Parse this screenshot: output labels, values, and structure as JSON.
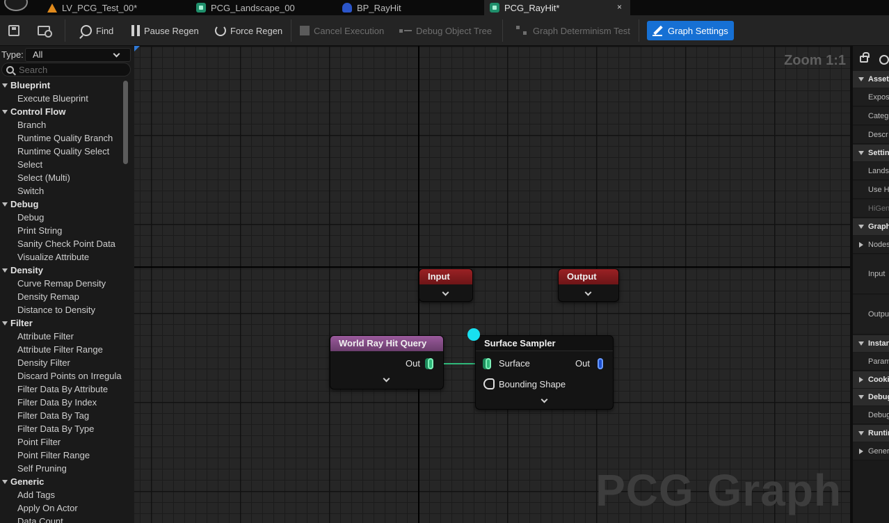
{
  "tabs": [
    {
      "label": "LV_PCG_Test_00*",
      "icon": "level-icon"
    },
    {
      "label": "PCG_Landscape_00",
      "icon": "pcg-graph-icon"
    },
    {
      "label": "BP_RayHit",
      "icon": "blueprint-icon"
    },
    {
      "label": "PCG_RayHit*",
      "icon": "pcg-graph-icon",
      "active": true
    }
  ],
  "tab_close_glyph": "×",
  "toolbar": {
    "find": "Find",
    "pause_regen": "Pause Regen",
    "force_regen": "Force Regen",
    "cancel_execution": "Cancel Execution",
    "debug_object_tree": "Debug Object Tree",
    "graph_determinism_test": "Graph Determinism Test",
    "graph_settings": "Graph Settings"
  },
  "palette": {
    "type_label": "Type:",
    "type_value": "All",
    "search_placeholder": "Search",
    "categories": [
      {
        "name": "Blueprint",
        "items": [
          "Execute Blueprint"
        ]
      },
      {
        "name": "Control Flow",
        "items": [
          "Branch",
          "Runtime Quality Branch",
          "Runtime Quality Select",
          "Select",
          "Select (Multi)",
          "Switch"
        ]
      },
      {
        "name": "Debug",
        "items": [
          "Debug",
          "Print String",
          "Sanity Check Point Data",
          "Visualize Attribute"
        ]
      },
      {
        "name": "Density",
        "items": [
          "Curve Remap Density",
          "Density Remap",
          "Distance to Density"
        ]
      },
      {
        "name": "Filter",
        "items": [
          "Attribute Filter",
          "Attribute Filter Range",
          "Density Filter",
          "Discard Points on Irregula",
          "Filter Data By Attribute",
          "Filter Data By Index",
          "Filter Data By Tag",
          "Filter Data By Type",
          "Point Filter",
          "Point Filter Range",
          "Self Pruning"
        ]
      },
      {
        "name": "Generic",
        "items": [
          "Add Tags",
          "Apply On Actor",
          "Data Count"
        ]
      }
    ]
  },
  "graph": {
    "zoom": "Zoom 1:1",
    "watermark": "PCG Graph",
    "nodes": {
      "input": {
        "title": "Input",
        "color": "#8f1d20"
      },
      "output": {
        "title": "Output",
        "color": "#8f1d20"
      },
      "world_ray_hit_query": {
        "title": "World Ray Hit Query",
        "color": "#8a4f8c",
        "out_label": "Out"
      },
      "surface_sampler": {
        "title": "Surface Sampler",
        "surface_label": "Surface",
        "out_label": "Out",
        "bounding_shape_label": "Bounding Shape"
      }
    }
  },
  "details": {
    "rows": [
      {
        "kind": "section",
        "label": "Asset"
      },
      {
        "kind": "prop",
        "label": "Expos"
      },
      {
        "kind": "prop",
        "label": "Categ"
      },
      {
        "kind": "prop",
        "label": "Descr"
      },
      {
        "kind": "section",
        "label": "Settin"
      },
      {
        "kind": "prop",
        "label": "Lands"
      },
      {
        "kind": "prop",
        "label": "Use H"
      },
      {
        "kind": "prop",
        "label": "HiGen",
        "dim": true
      },
      {
        "kind": "section",
        "label": "Graph"
      },
      {
        "kind": "prop",
        "label": "Nodes",
        "arrow": true
      },
      {
        "kind": "prop",
        "label": "Input",
        "tall": true
      },
      {
        "kind": "prop",
        "label": "Outpu",
        "tall": true
      },
      {
        "kind": "section",
        "label": "Instan"
      },
      {
        "kind": "prop",
        "label": "Param"
      },
      {
        "kind": "section",
        "label": "Cookir",
        "closed": true
      },
      {
        "kind": "section",
        "label": "Debug"
      },
      {
        "kind": "prop",
        "label": "Debug"
      },
      {
        "kind": "section",
        "label": "Runtin"
      },
      {
        "kind": "prop",
        "label": "Gener",
        "arrow": true
      }
    ]
  },
  "colors": {
    "accent": "#1670d4",
    "wire_green": "#2fb87a",
    "exec_cyan": "#18e0f0"
  }
}
